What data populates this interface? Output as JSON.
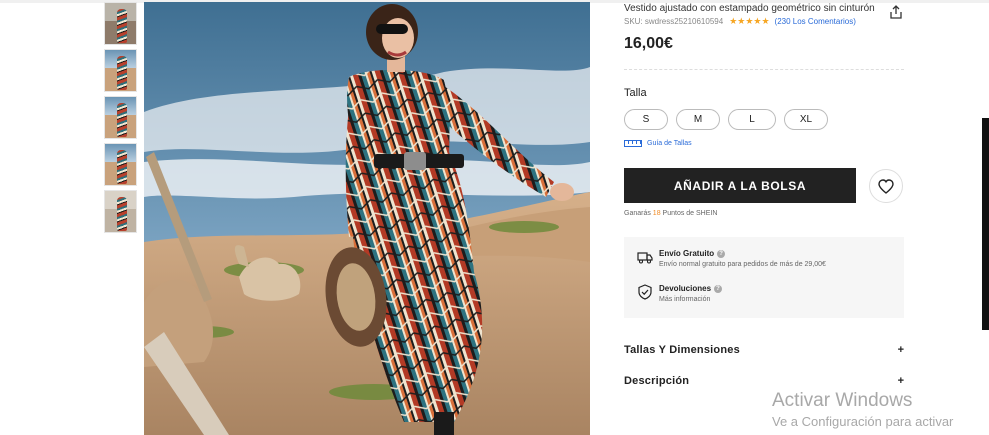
{
  "product": {
    "title": "Vestido ajustado con estampado geométrico sin cinturón",
    "sku": "SKU: swdress25210610594",
    "rating_stars": "★★★★★",
    "reviews": "(230 Los Comentarios)",
    "price": "16,00€"
  },
  "size": {
    "label": "Talla",
    "options": [
      "S",
      "M",
      "L",
      "XL"
    ],
    "guide_label": "Guía de Tallas"
  },
  "actions": {
    "add_to_bag": "AÑADIR A LA BOLSA",
    "points_prefix": "Ganarás ",
    "points_value": "18",
    "points_suffix": " Puntos de SHEIN"
  },
  "shipping": {
    "free_title": "Envío Gratuito",
    "free_sub": "Envío normal gratuito para pedidos de más de 29,00€",
    "returns_title": "Devoluciones",
    "returns_sub": "Más información"
  },
  "accordion": {
    "sizes_title": "Tallas Y Dimensiones",
    "description_title": "Descripción",
    "plus": "+"
  },
  "watermark": {
    "line1": "Activar Windows",
    "line2": "Ve a Configuración para activar"
  },
  "icons": {
    "share": "share-icon",
    "heart": "heart-icon",
    "truck": "truck-icon",
    "shield": "shield-icon",
    "ruler": "ruler-icon"
  },
  "colors": {
    "accent_link": "#2a6bd8",
    "star": "#f6a623",
    "points": "#f08a24",
    "button_bg": "#222222"
  }
}
